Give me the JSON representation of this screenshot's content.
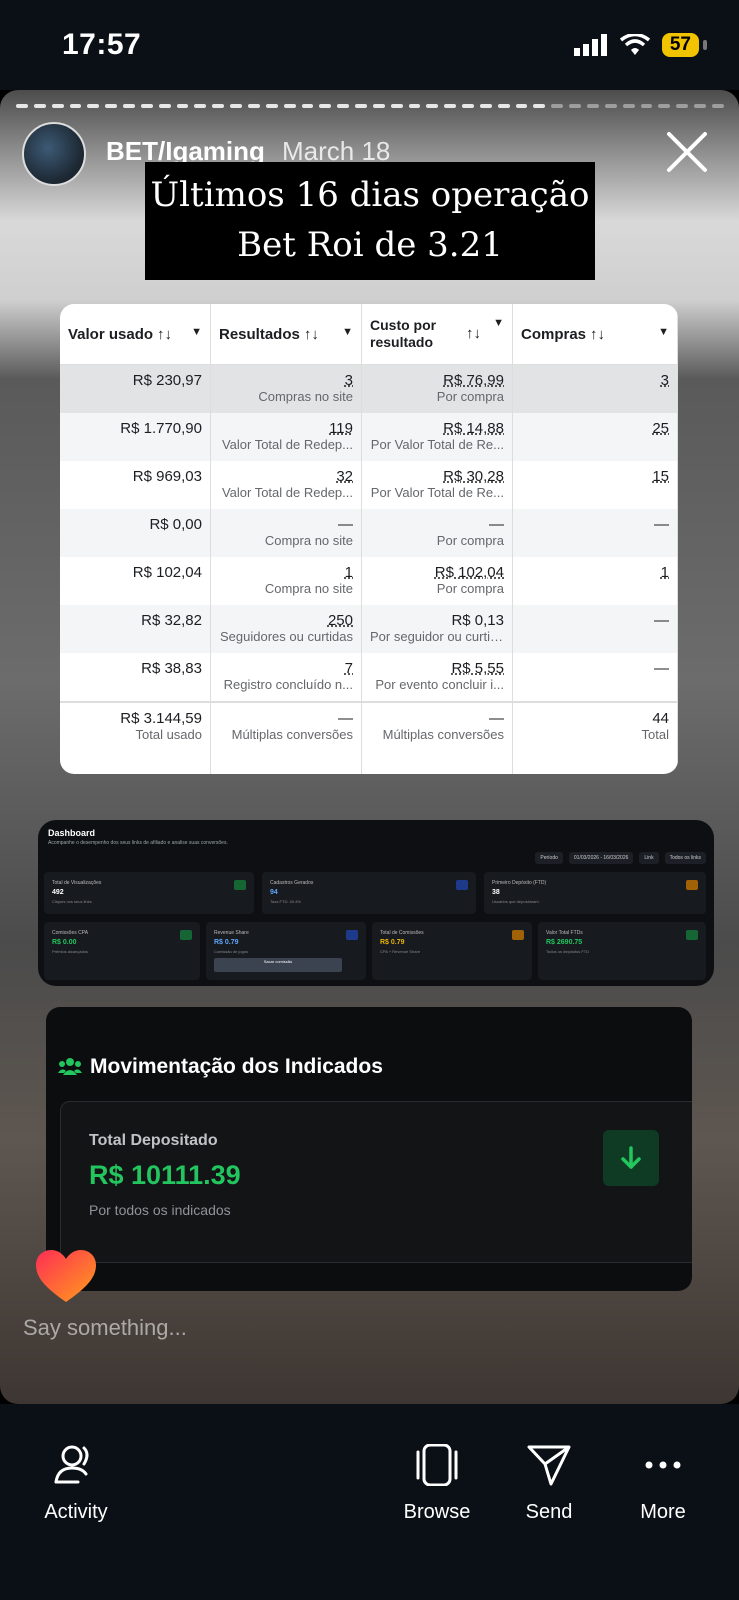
{
  "status_bar": {
    "time": "17:57",
    "battery": "57"
  },
  "story": {
    "username": "BET/Igaming",
    "date": "March 18",
    "caption_line1": "Últimos 16 dias operação",
    "caption_line2": "Bet Roi de 3.21",
    "reply_placeholder": "Say something..."
  },
  "table": {
    "headers": [
      {
        "label": "Valor usado",
        "sort": "↑↓"
      },
      {
        "label": "Resultados",
        "sort": "↑↓"
      },
      {
        "label": "Custo por resultado",
        "sort": "↑↓"
      },
      {
        "label": "Compras",
        "sort": "↑↓"
      }
    ],
    "rows": [
      {
        "valor": "R$ 230,97",
        "res": "3",
        "res_sub": "Compras no site",
        "custo": "R$ 76,99",
        "custo_sub": "Por compra",
        "compras": "3"
      },
      {
        "valor": "R$ 1.770,90",
        "res": "119",
        "res_sub": "Valor Total de Redep...",
        "custo": "R$ 14,88",
        "custo_sub": "Por Valor Total de Re...",
        "compras": "25"
      },
      {
        "valor": "R$ 969,03",
        "res": "32",
        "res_sub": "Valor Total de Redep...",
        "custo": "R$ 30,28",
        "custo_sub": "Por Valor Total de Re...",
        "compras": "15"
      },
      {
        "valor": "R$ 0,00",
        "res": "—",
        "res_sub": "Compra no site",
        "custo": "—",
        "custo_sub": "Por compra",
        "compras": "—"
      },
      {
        "valor": "R$ 102,04",
        "res": "1",
        "res_sub": "Compra no site",
        "custo": "R$ 102,04",
        "custo_sub": "Por compra",
        "compras": "1"
      },
      {
        "valor": "R$ 32,82",
        "res": "250",
        "res_sub": "Seguidores ou curtidas",
        "custo": "R$ 0,13",
        "custo_sub": "Por seguidor ou curtida",
        "compras": "—"
      },
      {
        "valor": "R$ 38,83",
        "res": "7",
        "res_sub": "Registro concluído n...",
        "custo": "R$ 5,55",
        "custo_sub": "Por evento concluir i...",
        "compras": "—"
      }
    ],
    "total": {
      "valor": "R$ 3.144,59",
      "valor_sub": "Total usado",
      "res": "—",
      "res_sub": "Múltiplas conversões",
      "custo": "—",
      "custo_sub": "Múltiplas conversões",
      "compras": "44",
      "compras_sub": "Total"
    }
  },
  "dashboard": {
    "title": "Dashboard",
    "subtitle": "Acompanhe o desempenho dos seus links de afiliado e analise suas conversões.",
    "filter_period": "Período",
    "filter_dates": "01/03/2026 - 16/03/2026",
    "filter_link": "Link",
    "filter_all_links": "Todos os links",
    "cards": [
      {
        "label": "Total de Visualizações",
        "value": "492",
        "hint": "Cliques nos seus links",
        "color": "#22c55e"
      },
      {
        "label": "Cadastros Gerados",
        "value": "94",
        "hint": "Taxa FTD: 40.4%",
        "color": "#3b82f6"
      },
      {
        "label": "Primeiro Depósito (FTD)",
        "value": "38",
        "hint": "Usuários que depositaram",
        "color": "#eab308"
      },
      {
        "label": "Comissões CPA",
        "value": "R$ 0.00",
        "hint": "Prêmios alcançados",
        "color": "#22c55e"
      },
      {
        "label": "Revenue Share",
        "value": "R$ 0.79",
        "hint": "Comissão de jogos",
        "color": "#3b82f6",
        "button": "Sacar comissão"
      },
      {
        "label": "Total de Comissões",
        "value": "R$ 0.79",
        "hint": "CPA + Revenue Share",
        "color": "#eab308"
      },
      {
        "label": "Valor Total FTDs",
        "value": "R$ 2690.75",
        "hint": "Todos os depósitos FTD",
        "color": "#22c55e"
      }
    ]
  },
  "movimentacao": {
    "title": "Movimentação dos Indicados",
    "label": "Total Depositado",
    "value": "R$ 10111.39",
    "sub": "Por todos os indicados"
  },
  "nav": {
    "activity": "Activity",
    "browse": "Browse",
    "send": "Send",
    "more": "More"
  }
}
